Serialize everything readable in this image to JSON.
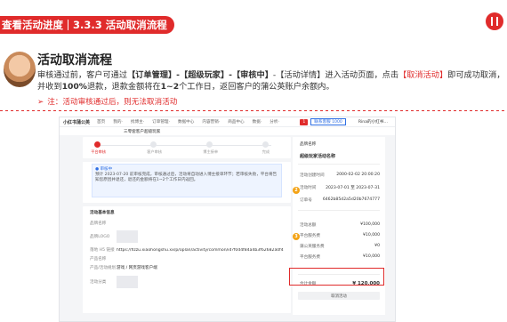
{
  "header": {
    "section": "查看活动进度",
    "subsection": "3.3.3 活动取消流程"
  },
  "content": {
    "title": "活动取消流程",
    "desc_parts": {
      "p1": "审核通过前，客户可通过",
      "p2": "【订单管理】-【超级玩家】-【审核中】",
      "p3": "-【活动详情】",
      "p4": "进入活动页面，点击",
      "p5": "【取消活动】",
      "p6": "即可成功取消，并收到",
      "p7": "100%",
      "p8": "退款，退款金额将在",
      "p9": "1~2",
      "p10": "个工作日，返回客户的蒲公英账户余额内。"
    },
    "note_arrow": "➢",
    "note": "注：活动审核通过后，则无法取消活动"
  },
  "screenshot": {
    "logo": "小红书蒲公英",
    "nav_items": [
      "首页",
      "我的·",
      "找博主·",
      "订单管理·",
      "数据中心",
      "内容营销·",
      "商品中心",
      "数据·",
      "分析·"
    ],
    "nav_btn_red": "1",
    "nav_btn_blue": "联系客服 1000",
    "nav_user": "Rina的小红书…",
    "sub_title": "三零套客户超级玩家",
    "steps": [
      "平台审核",
      "客户审核",
      "博主接单",
      "完成"
    ],
    "notice_title": "● 审核中",
    "notice_text": "预计 2023-07-20 前审核完成，审核通过后，活动将自动进入博主接单环节；若审核失败，平台将告知您原因并退还，退还的金额将在1~2个工作日内返回。",
    "basic_title": "活动基本信息",
    "rows": [
      {
        "k": "品牌名称",
        "v": ""
      },
      {
        "k": "品牌LOGO",
        "v": ""
      },
      {
        "k": "落地 H5 链接",
        "v": "https://fizzu.xiaohongshu.xx/p/oplan/activity/common/id?f0d4f84a4b3f62682a0f4c15fb"
      },
      {
        "k": "产品名称",
        "v": ""
      },
      {
        "k": "产品/活动规划",
        "v": "游戏 / 网页游戏客户端"
      },
      {
        "k": "活动分类",
        "v": ""
      }
    ],
    "right_head": "品牌名称",
    "right_name": "超级玩家活动名称",
    "right_rows": [
      {
        "k": "活动创建时间",
        "v": "2000-02-02 20:00:20"
      },
      {
        "k": "活动时间",
        "v": "2023-07-01 至 2023-07-31"
      },
      {
        "k": "订单号",
        "v": "6462b85d2a5d20b7674777"
      },
      {
        "k": "活动总额",
        "v": "¥100,000"
      },
      {
        "k": "平台服务费",
        "v": "¥10,000"
      },
      {
        "k": "蒲公英服务费",
        "v": "¥0"
      },
      {
        "k": "平台服务费",
        "v": "¥10,000"
      }
    ],
    "total_label": "合计金额",
    "total_value": "¥ 120,000",
    "cancel_label": "取消活动",
    "badge2": "2",
    "badge3": "3"
  }
}
